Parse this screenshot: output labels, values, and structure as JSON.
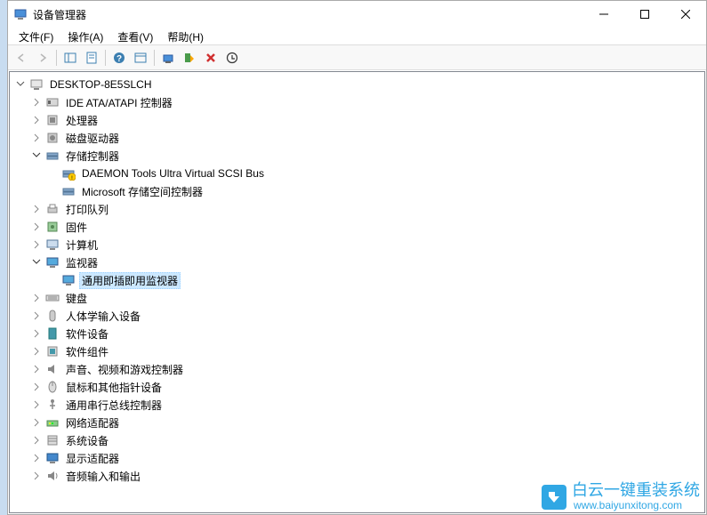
{
  "window": {
    "title": "设备管理器"
  },
  "menubar": {
    "file": "文件(F)",
    "action": "操作(A)",
    "view": "查看(V)",
    "help": "帮助(H)"
  },
  "tree": {
    "root": "DESKTOP-8E5SLCH",
    "items": [
      {
        "label": "IDE ATA/ATAPI 控制器",
        "expanded": false,
        "icon": "ide"
      },
      {
        "label": "处理器",
        "expanded": false,
        "icon": "cpu"
      },
      {
        "label": "磁盘驱动器",
        "expanded": false,
        "icon": "disk"
      },
      {
        "label": "存储控制器",
        "expanded": true,
        "icon": "storage",
        "children": [
          {
            "label": "DAEMON Tools Ultra Virtual SCSI Bus",
            "icon": "storage-warn"
          },
          {
            "label": "Microsoft 存储空间控制器",
            "icon": "storage"
          }
        ]
      },
      {
        "label": "打印队列",
        "expanded": false,
        "icon": "printer"
      },
      {
        "label": "固件",
        "expanded": false,
        "icon": "firmware"
      },
      {
        "label": "计算机",
        "expanded": false,
        "icon": "computer"
      },
      {
        "label": "监视器",
        "expanded": true,
        "icon": "monitor",
        "children": [
          {
            "label": "通用即插即用监视器",
            "icon": "monitor",
            "selected": true
          }
        ]
      },
      {
        "label": "键盘",
        "expanded": false,
        "icon": "keyboard"
      },
      {
        "label": "人体学输入设备",
        "expanded": false,
        "icon": "hid"
      },
      {
        "label": "软件设备",
        "expanded": false,
        "icon": "software"
      },
      {
        "label": "软件组件",
        "expanded": false,
        "icon": "component"
      },
      {
        "label": "声音、视频和游戏控制器",
        "expanded": false,
        "icon": "sound"
      },
      {
        "label": "鼠标和其他指针设备",
        "expanded": false,
        "icon": "mouse"
      },
      {
        "label": "通用串行总线控制器",
        "expanded": false,
        "icon": "usb"
      },
      {
        "label": "网络适配器",
        "expanded": false,
        "icon": "network"
      },
      {
        "label": "系统设备",
        "expanded": false,
        "icon": "system"
      },
      {
        "label": "显示适配器",
        "expanded": false,
        "icon": "display"
      },
      {
        "label": "音频输入和输出",
        "expanded": false,
        "icon": "audio"
      }
    ]
  },
  "watermark": {
    "text": "白云一键重装系统",
    "url": "www.baiyunxitong.com"
  }
}
